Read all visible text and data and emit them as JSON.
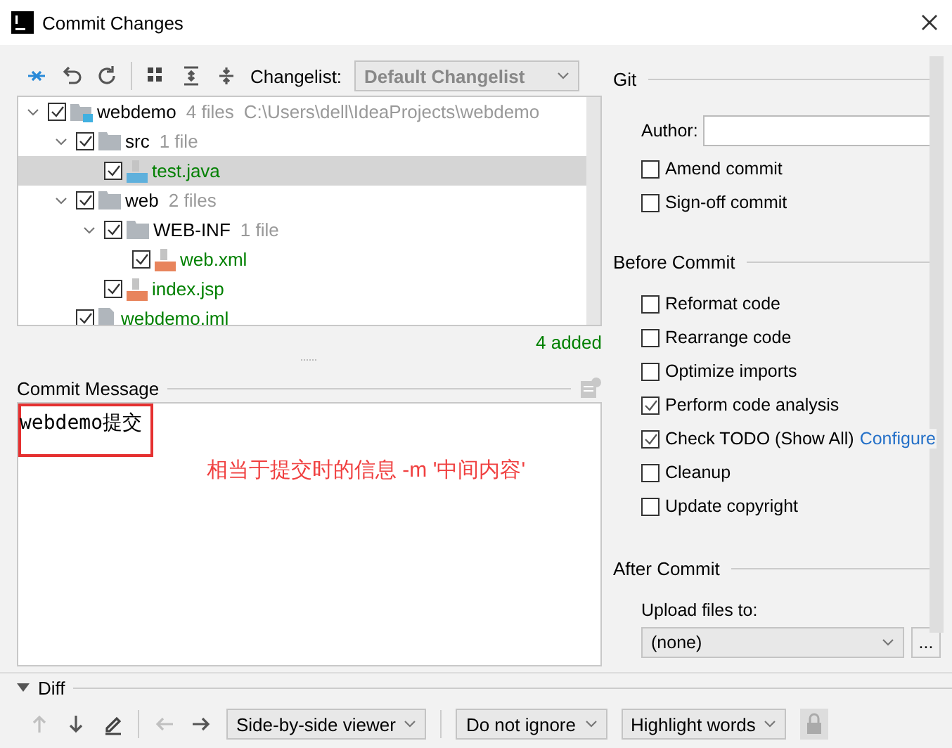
{
  "window": {
    "title": "Commit Changes"
  },
  "toolbar": {
    "changelist_label": "Changelist:",
    "changelist": "Default Changelist"
  },
  "tree": [
    {
      "name": "webdemo",
      "info": "4 files",
      "path": "C:\\Users\\dell\\IdeaProjects\\webdemo",
      "kind": "module",
      "checked": true,
      "expanded": true,
      "selected": false,
      "added": false,
      "children": [
        {
          "name": "src",
          "info": "1 file",
          "kind": "folder",
          "checked": true,
          "expanded": true,
          "selected": false,
          "added": false,
          "children": [
            {
              "name": "test.java",
              "kind": "java",
              "checked": true,
              "selected": true,
              "added": true
            }
          ]
        },
        {
          "name": "web",
          "info": "2 files",
          "kind": "folder",
          "checked": true,
          "expanded": true,
          "selected": false,
          "added": false,
          "children": [
            {
              "name": "WEB-INF",
              "info": "1 file",
              "kind": "folder",
              "checked": true,
              "expanded": true,
              "selected": false,
              "added": false,
              "children": [
                {
                  "name": "web.xml",
                  "kind": "xml",
                  "checked": true,
                  "selected": false,
                  "added": true
                }
              ]
            },
            {
              "name": "index.jsp",
              "kind": "jsp",
              "checked": true,
              "selected": false,
              "added": true
            }
          ]
        },
        {
          "name": "webdemo.iml",
          "kind": "iml",
          "checked": true,
          "selected": false,
          "added": true
        }
      ]
    }
  ],
  "tree_summary": "4 added",
  "commit_message": {
    "label": "Commit Message",
    "value": "webdemo提交"
  },
  "annotation": "相当于提交时的信息 -m '中间内容'",
  "git": {
    "title": "Git",
    "author_label": "Author:",
    "options": [
      {
        "label": "Amend commit",
        "checked": false
      },
      {
        "label": "Sign-off commit",
        "checked": false
      }
    ]
  },
  "before_commit": {
    "title": "Before Commit",
    "options": [
      {
        "label": "Reformat code",
        "checked": false
      },
      {
        "label": "Rearrange code",
        "checked": false
      },
      {
        "label": "Optimize imports",
        "checked": false
      },
      {
        "label": "Perform code analysis",
        "checked": true
      },
      {
        "label": "Check TODO (Show All)",
        "checked": true,
        "link": "Configure"
      },
      {
        "label": "Cleanup",
        "checked": false
      },
      {
        "label": "Update copyright",
        "checked": false
      }
    ]
  },
  "after_commit": {
    "title": "After Commit",
    "upload_label": "Upload files to:",
    "upload_target": "(none)",
    "browse": "..."
  },
  "diff": {
    "title": "Diff",
    "expanded": true,
    "viewer": "Side-by-side viewer",
    "ignore": "Do not ignore",
    "highlight": "Highlight words"
  }
}
